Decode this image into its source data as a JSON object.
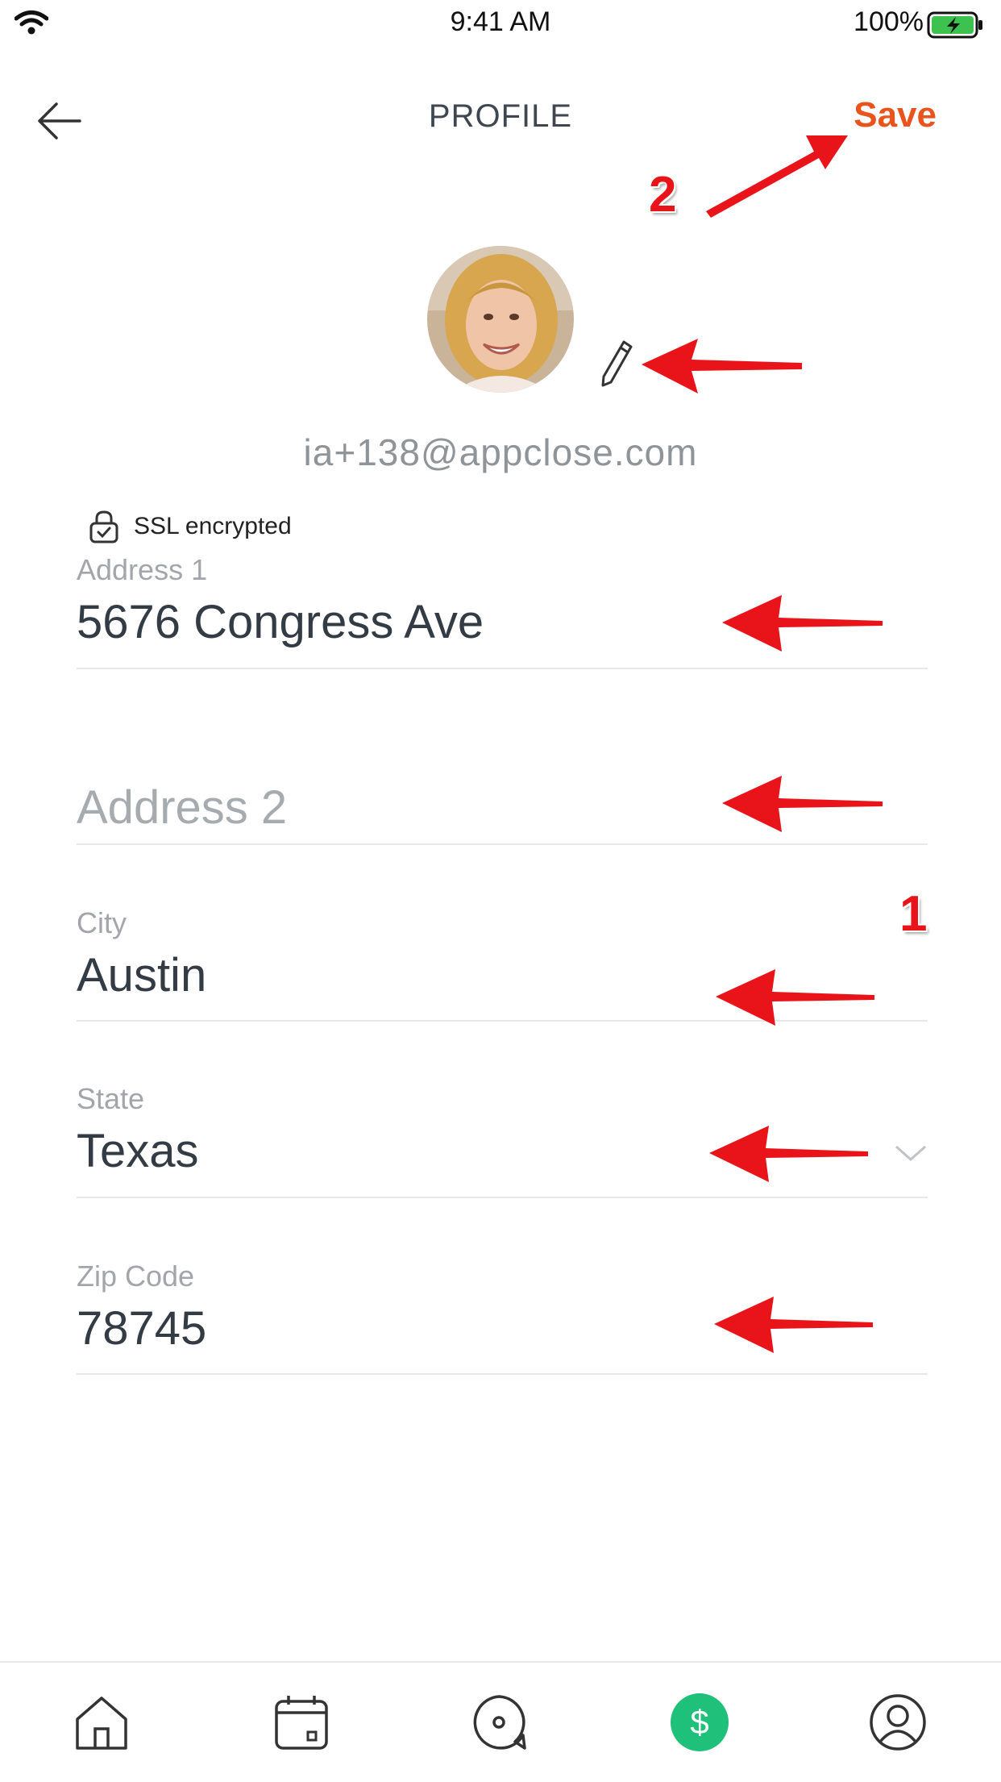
{
  "status_bar": {
    "time": "9:41 AM",
    "battery": "100%"
  },
  "nav": {
    "title": "PROFILE",
    "save_label": "Save"
  },
  "profile": {
    "email": "ia+138@appclose.com",
    "ssl_label": "SSL encrypted"
  },
  "form": {
    "address1": {
      "label": "Address 1",
      "value": "5676 Congress Ave"
    },
    "address2": {
      "placeholder": "Address 2"
    },
    "city": {
      "label": "City",
      "value": "Austin"
    },
    "state": {
      "label": "State",
      "value": "Texas"
    },
    "zip": {
      "label": "Zip Code",
      "value": "78745"
    }
  },
  "annotations": {
    "step_1": "1",
    "step_2": "2",
    "arrow_color": "#e8141a"
  },
  "tabbar": {
    "items": [
      "home-icon",
      "calendar-icon",
      "chat-icon",
      "payments-icon",
      "profile-icon"
    ],
    "active": "payments-icon"
  },
  "colors": {
    "accent": "#e8541b",
    "active_tab": "#1ec07a"
  }
}
